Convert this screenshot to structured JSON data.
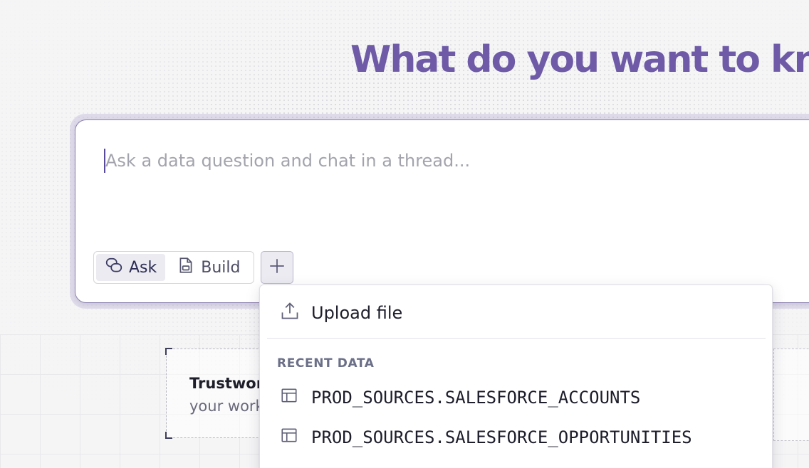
{
  "hero": {
    "title": "What do you want to know?"
  },
  "prompt": {
    "placeholder": "Ask a data question and chat in a thread...",
    "value": ""
  },
  "modes": {
    "ask_label": "Ask",
    "build_label": "Build",
    "active": "Ask"
  },
  "add_button": {
    "icon": "plus-icon"
  },
  "card": {
    "title": "Trustwor",
    "subtitle": "your work"
  },
  "dropdown": {
    "upload_label": "Upload file",
    "section_title": "RECENT DATA",
    "recent_items": [
      {
        "label": "PROD_SOURCES.SALESFORCE_ACCOUNTS",
        "icon": "table-icon"
      },
      {
        "label": "PROD_SOURCES.SALESFORCE_OPPORTUNITIES",
        "icon": "table-icon"
      }
    ]
  },
  "colors": {
    "accent": "#6e5aa6",
    "border": "#8e82b0"
  }
}
